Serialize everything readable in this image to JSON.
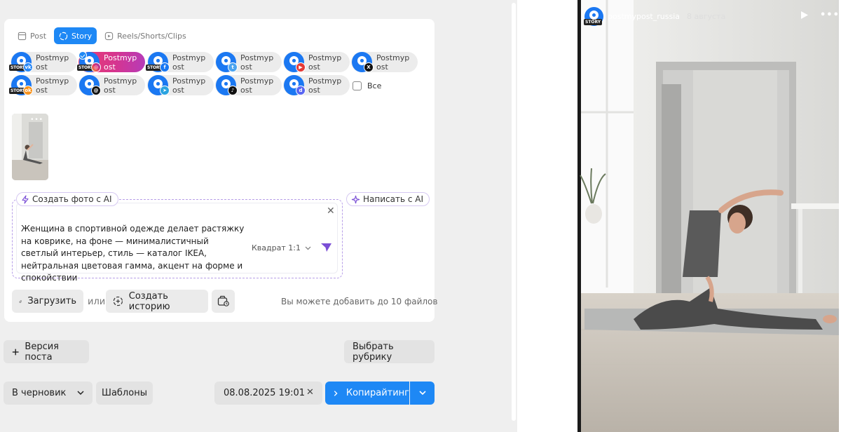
{
  "tabs": [
    {
      "label": "Post",
      "active": false
    },
    {
      "label": "Story",
      "active": true
    },
    {
      "label": "Reels/Shorts/Clips",
      "active": false
    }
  ],
  "accounts": [
    {
      "name_line1": "Postmyp",
      "name_line2": "ost",
      "network": "vk",
      "selected": false
    },
    {
      "name_line1": "Postmyp",
      "name_line2": "ost",
      "network": "instagram",
      "selected": true
    },
    {
      "name_line1": "Postmyp",
      "name_line2": "ost",
      "network": "facebook",
      "selected": false
    },
    {
      "name_line1": "Postmyp",
      "name_line2": "ost",
      "network": "twitter",
      "selected": false
    },
    {
      "name_line1": "Postmyp",
      "name_line2": "ost",
      "network": "youtube",
      "selected": false
    },
    {
      "name_line1": "Postmyp",
      "name_line2": "ost",
      "network": "x",
      "selected": false
    },
    {
      "name_line1": "Postmyp",
      "name_line2": "ost",
      "network": "odnoklassniki",
      "selected": false
    },
    {
      "name_line1": "Postmyp",
      "name_line2": "ost",
      "network": "threads",
      "selected": false
    },
    {
      "name_line1": "Postmyp",
      "name_line2": "ost",
      "network": "telegram",
      "selected": false
    },
    {
      "name_line1": "Postmyp",
      "name_line2": "ost",
      "network": "tiktok",
      "selected": false
    },
    {
      "name_line1": "Postmyp",
      "name_line2": "ost",
      "network": "discord",
      "selected": false
    }
  ],
  "story_badge": "STORY",
  "all_label": "Все",
  "ai": {
    "create_photo_label": "Создать фото с AI",
    "write_label": "Написать с AI",
    "prompt": "Женщина в спортивной одежде делает растяжку на коврике, на фоне — минималистичный светлый интерьер, стиль — каталог IKEA, нейтральная цветовая гамма, акцент на форме и спокойствии",
    "ratio": "Квадрат 1:1"
  },
  "upload": {
    "upload_label": "Загрузить",
    "or_label": "или",
    "create_story_label": "Создать историю",
    "hint": "Вы можете добавить до 10 файлов"
  },
  "post_version_label": "Версия поста",
  "rubric_label": "Выбрать рубрику",
  "footer": {
    "draft_label": "В черновик",
    "templates_label": "Шаблоны",
    "date": "08.08.2025 19:01",
    "copywriting_label": "Копирайтинг"
  },
  "preview": {
    "username": "postmypost_russia",
    "date": "8 августа"
  },
  "colors": {
    "accent": "#1e88f5",
    "ai_border": "#b79ee8",
    "instagram_gradient_start": "#e83d70",
    "instagram_gradient_end": "#b63bb8"
  }
}
